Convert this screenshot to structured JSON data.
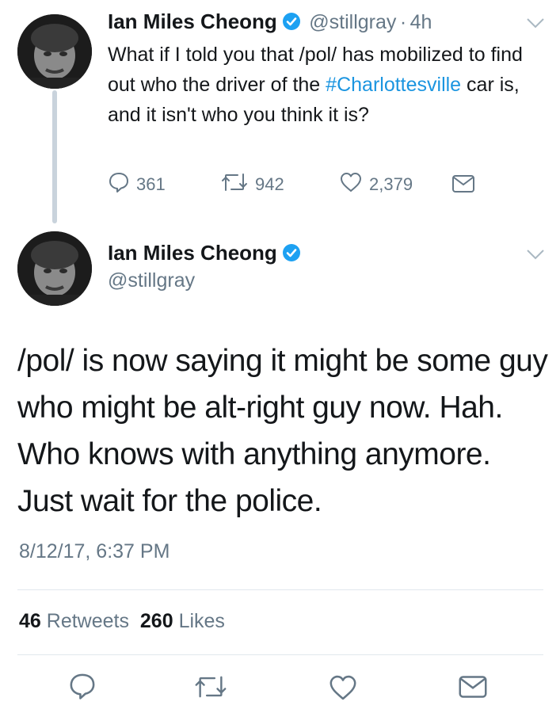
{
  "tweet1": {
    "author_name": "Ian Miles Cheong",
    "handle": "@stillgray",
    "separator": "·",
    "age": "4h",
    "text_before": "What if I told you that /pol/ has mobilized to find out who the driver of the ",
    "hashtag": "#Charlottesville",
    "text_after": " car is, and it isn't who you think it is?",
    "replies": "361",
    "retweets": "942",
    "likes": "2,379"
  },
  "tweet2": {
    "author_name": "Ian Miles Cheong",
    "handle": "@stillgray",
    "text": "/pol/ is now saying it might be some guy who might be alt-right guy now. Hah. Who knows with anything anymore. Just wait for the police.",
    "timestamp": "8/12/17, 6:37 PM",
    "retweet_count": "46",
    "retweet_label": "Retweets",
    "like_count": "260",
    "like_label": "Likes"
  },
  "colors": {
    "accent": "#1b95e0",
    "verified": "#1da1f2",
    "muted": "#657786",
    "divider": "#e1e8ed"
  },
  "icons": {
    "reply": "reply-icon",
    "retweet": "retweet-icon",
    "like": "heart-icon",
    "dm": "envelope-icon",
    "menu": "chevron-down-icon",
    "verified": "verified-badge-icon"
  }
}
